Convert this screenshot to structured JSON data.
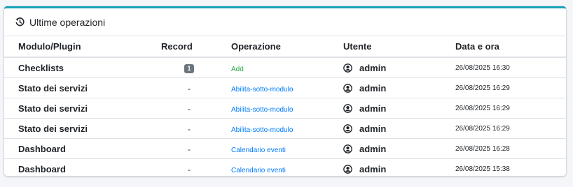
{
  "card": {
    "title": "Ultime operazioni",
    "title_icon": "history-icon"
  },
  "table": {
    "columns": [
      "Modulo/Plugin",
      "Record",
      "Operazione",
      "Utente",
      "Data e ora"
    ],
    "rows": [
      {
        "module": "Checklists",
        "record": "1",
        "record_is_badge": true,
        "operation": "Add",
        "op_color": "#28a745",
        "user": "admin",
        "datetime": "26/08/2025 16:30"
      },
      {
        "module": "Stato dei servizi",
        "record": "-",
        "record_is_badge": false,
        "operation": "Abilita-sotto-modulo",
        "op_color": "#007bff",
        "user": "admin",
        "datetime": "26/08/2025 16:29"
      },
      {
        "module": "Stato dei servizi",
        "record": "-",
        "record_is_badge": false,
        "operation": "Abilita-sotto-modulo",
        "op_color": "#007bff",
        "user": "admin",
        "datetime": "26/08/2025 16:29"
      },
      {
        "module": "Stato dei servizi",
        "record": "-",
        "record_is_badge": false,
        "operation": "Abilita-sotto-modulo",
        "op_color": "#007bff",
        "user": "admin",
        "datetime": "26/08/2025 16:29"
      },
      {
        "module": "Dashboard",
        "record": "-",
        "record_is_badge": false,
        "operation": "Calendario eventi",
        "op_color": "#007bff",
        "user": "admin",
        "datetime": "26/08/2025 16:28"
      },
      {
        "module": "Dashboard",
        "record": "-",
        "record_is_badge": false,
        "operation": "Calendario eventi",
        "op_color": "#007bff",
        "user": "admin",
        "datetime": "26/08/2025 15:38"
      }
    ]
  },
  "colors": {
    "accent": "#17a2b8",
    "add": "#28a745",
    "link": "#007bff",
    "badge": "#6c757d"
  },
  "icons": {
    "user": "user-circle-icon"
  }
}
